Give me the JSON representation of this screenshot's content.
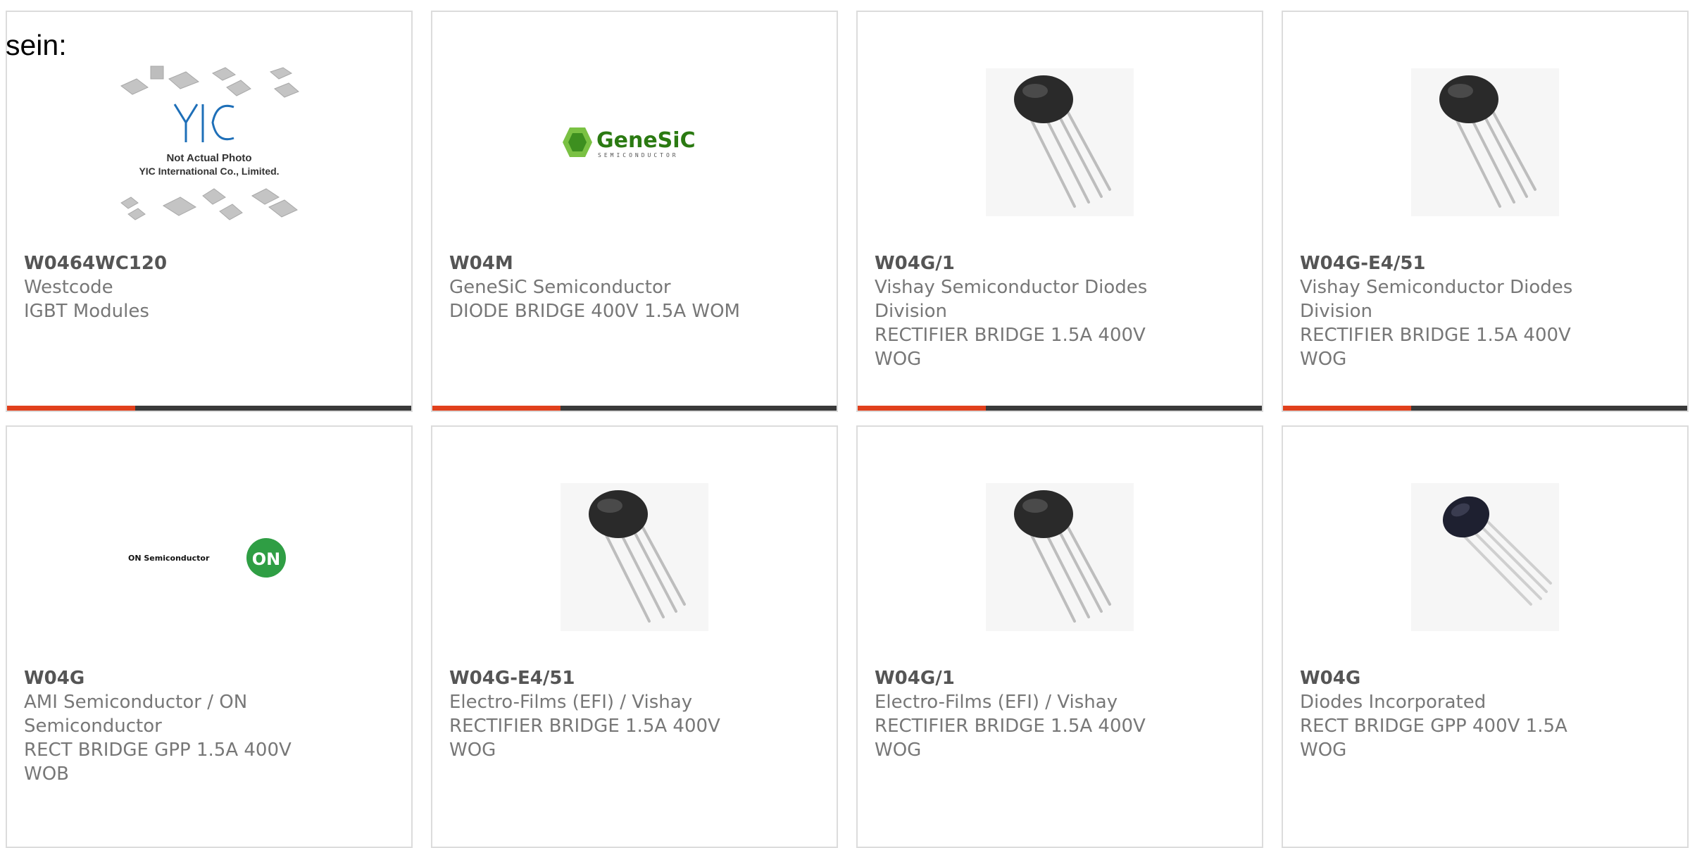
{
  "intro_text": "sein:",
  "colors": {
    "accent": "#e1401c",
    "bar": "#3a3a3a",
    "border": "#dcdcdc",
    "text": "#777777"
  },
  "cards": [
    {
      "part": "W0464WC120",
      "manufacturer": "Westcode",
      "description": "IGBT Modules",
      "image": "yic-not-actual-photo",
      "image_text": {
        "brand": "YIC",
        "line1": "Not Actual Photo",
        "line2": "YIC International Co., Limited."
      }
    },
    {
      "part": "W04M",
      "manufacturer": "GeneSiC Semiconductor",
      "description": "DIODE BRIDGE 400V 1.5A WOM",
      "image": "genesic-logo",
      "image_text": {
        "brand": "GeneSiC",
        "tag": "SEMICONDUCTOR"
      }
    },
    {
      "part": "W04G/1",
      "manufacturer": "Vishay Semiconductor Diodes Division",
      "description": "RECTIFIER BRIDGE 1.5A 400V WOG",
      "image": "bridge-rectifier-photo"
    },
    {
      "part": "W04G-E4/51",
      "manufacturer": "Vishay Semiconductor Diodes Division",
      "description": "RECTIFIER BRIDGE 1.5A 400V WOG",
      "image": "bridge-rectifier-photo"
    },
    {
      "part": "W04G",
      "manufacturer": "AMI Semiconductor / ON Semiconductor",
      "description": "RECT BRIDGE GPP 1.5A 400V WOB",
      "image": "on-semiconductor-logo",
      "image_text": {
        "brand": "ON Semiconductor",
        "badge": "ON"
      }
    },
    {
      "part": "W04G-E4/51",
      "manufacturer": "Electro-Films (EFI) / Vishay",
      "description": "RECTIFIER BRIDGE 1.5A 400V WOG",
      "image": "bridge-rectifier-photo"
    },
    {
      "part": "W04G/1",
      "manufacturer": "Electro-Films (EFI) / Vishay",
      "description": "RECTIFIER BRIDGE 1.5A 400V WOG",
      "image": "bridge-rectifier-photo"
    },
    {
      "part": "W04G",
      "manufacturer": "Diodes Incorporated",
      "description": "RECT BRIDGE GPP 400V 1.5A WOG",
      "image": "bridge-rectifier-photo"
    }
  ]
}
